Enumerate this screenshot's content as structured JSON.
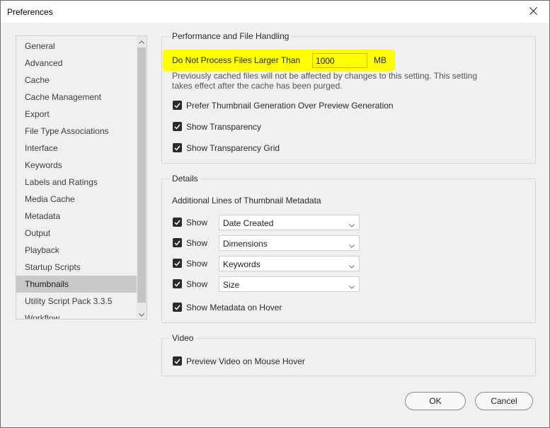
{
  "window": {
    "title": "Preferences",
    "close_icon": "close-icon"
  },
  "sidebar": {
    "items": [
      {
        "label": "General"
      },
      {
        "label": "Advanced"
      },
      {
        "label": "Cache"
      },
      {
        "label": "Cache Management"
      },
      {
        "label": "Export"
      },
      {
        "label": "File Type Associations"
      },
      {
        "label": "Interface"
      },
      {
        "label": "Keywords"
      },
      {
        "label": "Labels and Ratings"
      },
      {
        "label": "Media Cache"
      },
      {
        "label": "Metadata"
      },
      {
        "label": "Output"
      },
      {
        "label": "Playback"
      },
      {
        "label": "Startup Scripts"
      },
      {
        "label": "Thumbnails",
        "selected": true
      },
      {
        "label": "Utility Script Pack 3.3.5"
      },
      {
        "label": "Workflow"
      }
    ]
  },
  "performance": {
    "title": "Performance and File Handling",
    "max_size_label": "Do Not Process Files Larger Than",
    "max_size_value": "1000",
    "max_size_unit": "MB",
    "note_line1": "Previously cached files will not be affected by changes to this setting. This setting",
    "note_line2": "takes effect after the cache has been purged.",
    "options": [
      {
        "label": "Prefer Thumbnail Generation Over Preview Generation",
        "checked": true
      },
      {
        "label": "Show Transparency",
        "checked": true
      },
      {
        "label": "Show Transparency Grid",
        "checked": true
      }
    ]
  },
  "details": {
    "title": "Details",
    "subtitle": "Additional Lines of Thumbnail Metadata",
    "rows": [
      {
        "show_label": "Show",
        "checked": true,
        "value": "Date Created"
      },
      {
        "show_label": "Show",
        "checked": true,
        "value": "Dimensions"
      },
      {
        "show_label": "Show",
        "checked": true,
        "value": "Keywords"
      },
      {
        "show_label": "Show",
        "checked": true,
        "value": "Size"
      }
    ],
    "hover_label": "Show Metadata on Hover",
    "hover_checked": true
  },
  "video": {
    "title": "Video",
    "preview_label": "Preview Video on Mouse Hover",
    "preview_checked": true
  },
  "buttons": {
    "ok": "OK",
    "cancel": "Cancel"
  },
  "colors": {
    "highlight": "#ffff00",
    "selected_item": "#c8c8c8",
    "checkbox": "#2b2b2b"
  }
}
